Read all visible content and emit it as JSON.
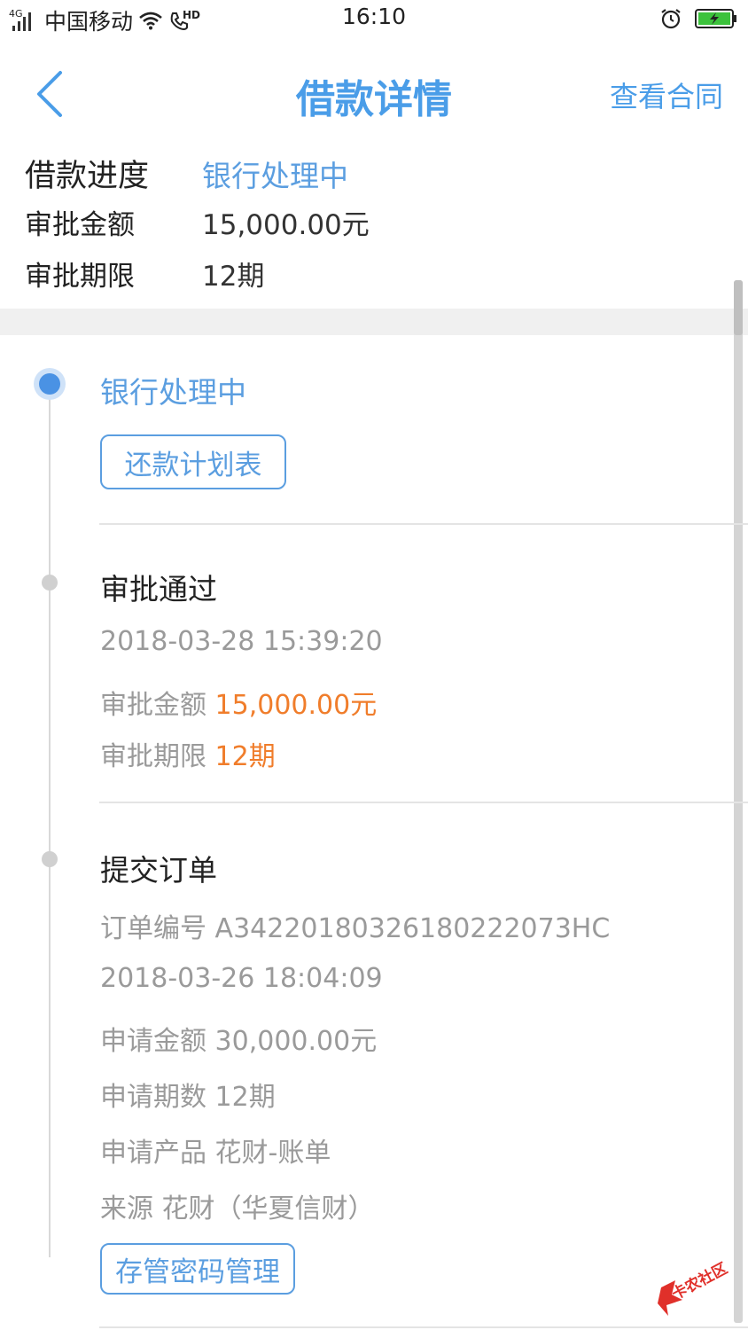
{
  "status_bar": {
    "network": "4G",
    "carrier": "中国移动",
    "hd": "HD",
    "time": "16:10"
  },
  "header": {
    "title": "借款详情",
    "contract_link": "查看合同"
  },
  "summary": {
    "progress_label": "借款进度",
    "progress_value": "银行处理中",
    "amount_label": "审批金额",
    "amount_value": "15,000.00元",
    "term_label": "审批期限",
    "term_value": "12期"
  },
  "timeline": {
    "step1": {
      "title": "银行处理中",
      "button": "还款计划表"
    },
    "step2": {
      "title": "审批通过",
      "datetime": "2018-03-28 15:39:20",
      "amount_label": "审批金额",
      "amount_value": "15,000.00元",
      "term_label": "审批期限",
      "term_value": "12期"
    },
    "step3": {
      "title": "提交订单",
      "order_label": "订单编号",
      "order_value": "A3422018032618022​2073HC",
      "datetime": "2018-03-26 18:04:09",
      "apply_amount_label": "申请金额",
      "apply_amount_value": "30,000.00元",
      "apply_term_label": "申请期数",
      "apply_term_value": "12期",
      "product_label": "申请产品",
      "product_value": "花财-账单",
      "source_label": "来源",
      "source_value": "花财（华夏信财）",
      "button": "存管密码管理"
    }
  },
  "watermark": {
    "text": "卡农社区"
  },
  "colors": {
    "accent": "#4a9de8",
    "highlight": "#f07d2b",
    "muted": "#9a9a9a"
  }
}
